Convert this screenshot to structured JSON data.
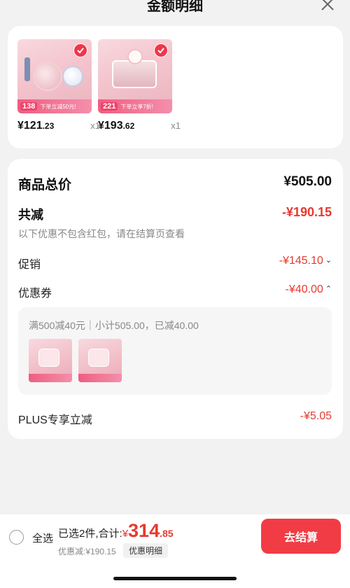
{
  "header": {
    "title": "金额明细"
  },
  "products": [
    {
      "price_int": "¥121",
      "price_dec": ".23",
      "qty": "x1",
      "badge_price": "138",
      "badge_text": "下单立减50元!"
    },
    {
      "price_int": "¥193",
      "price_dec": ".62",
      "qty": "x1",
      "badge_price": "221",
      "badge_text": "下单立享7折!"
    }
  ],
  "summary": {
    "total_label": "商品总价",
    "total_value": "¥505.00",
    "reduce_label": "共减",
    "reduce_value": "-¥190.15",
    "note": "以下优惠不包含红包，请在结算页查看",
    "promo_label": "促销",
    "promo_value": "-¥145.10",
    "coupon_label": "优惠券",
    "coupon_value": "-¥40.00",
    "coupon_desc": "满500减40元｜小计505.00，已减40.00",
    "plus_label": "PLUS专享立减",
    "plus_value": "-¥5.05"
  },
  "footer": {
    "select_all": "全选",
    "selected_text": "已选2件,合计:",
    "yen": "¥",
    "total_int": "314",
    "total_dec": ".85",
    "discount_text": "优惠减:¥190.15",
    "detail_button": "优惠明细",
    "checkout_button": "去结算"
  },
  "colors": {
    "accent": "#f23c45",
    "price_red": "#e8392f"
  },
  "icons": {
    "close": "close-icon",
    "check": "check-icon",
    "chevron_down": "chevron-down-icon",
    "chevron_up": "chevron-up-icon"
  }
}
